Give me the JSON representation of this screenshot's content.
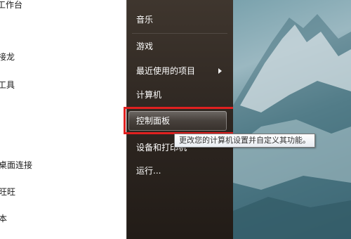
{
  "left_panel": {
    "items": [
      "工作台",
      "接龙",
      "工具",
      "桌面连接",
      "旺旺",
      "本"
    ]
  },
  "right_menu": {
    "items": [
      {
        "label": "音乐"
      },
      {
        "label": "游戏"
      },
      {
        "label": "最近使用的项目",
        "has_submenu": true
      },
      {
        "label": "计算机"
      },
      {
        "label": "控制面板",
        "highlighted": true
      },
      {
        "label": "设备和打印机"
      },
      {
        "label": "运行..."
      }
    ]
  },
  "tooltip": {
    "text": "更改您的计算机设置并自定义其功能。"
  },
  "colors": {
    "annotation_box": "#e02020",
    "menu_bg": "#2c2520",
    "menu_text": "#ffffff"
  }
}
